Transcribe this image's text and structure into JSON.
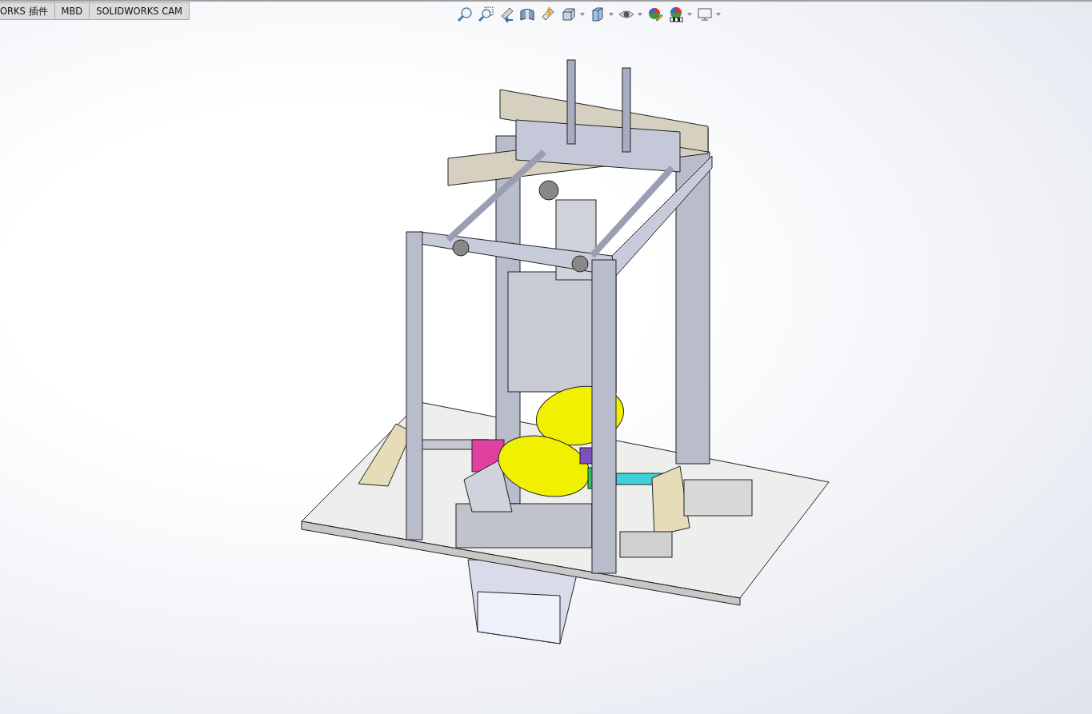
{
  "tabs": [
    {
      "label": "ORKS 插件",
      "selected": false
    },
    {
      "label": "MBD",
      "selected": false
    },
    {
      "label": "SOLIDWORKS CAM",
      "selected": false
    }
  ]
}
